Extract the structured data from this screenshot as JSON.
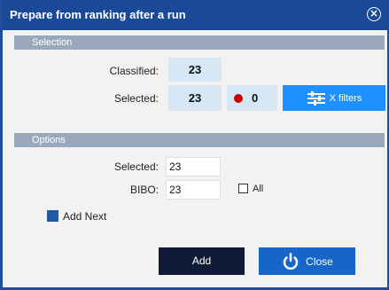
{
  "window": {
    "title": "Prepare from ranking after a run",
    "close_icon": "close-circle-icon"
  },
  "selection": {
    "header": "Selection",
    "classified_label": "Classified:",
    "classified_value": "23",
    "selected_label": "Selected:",
    "selected_value": "23",
    "red_count": "0",
    "filters_label": "X filters",
    "filters_icon": "sliders-icon"
  },
  "options": {
    "header": "Options",
    "selected_label": "Selected:",
    "selected_value": "23",
    "bibo_label": "BIBO:",
    "bibo_value": "23",
    "all_label": "All",
    "all_checked": false,
    "add_next_label": "Add Next",
    "add_next_checked": true
  },
  "footer": {
    "add_label": "Add",
    "close_label": "Close",
    "close_icon": "power-icon"
  },
  "colors": {
    "titlebar": "#1a4a97",
    "section_header": "#9aa8bd",
    "value_box": "#d6e8f5",
    "filters_button": "#1e90ff",
    "add_button": "#0f1a36",
    "close_button": "#1665c8",
    "red_dot": "#cc0000"
  }
}
